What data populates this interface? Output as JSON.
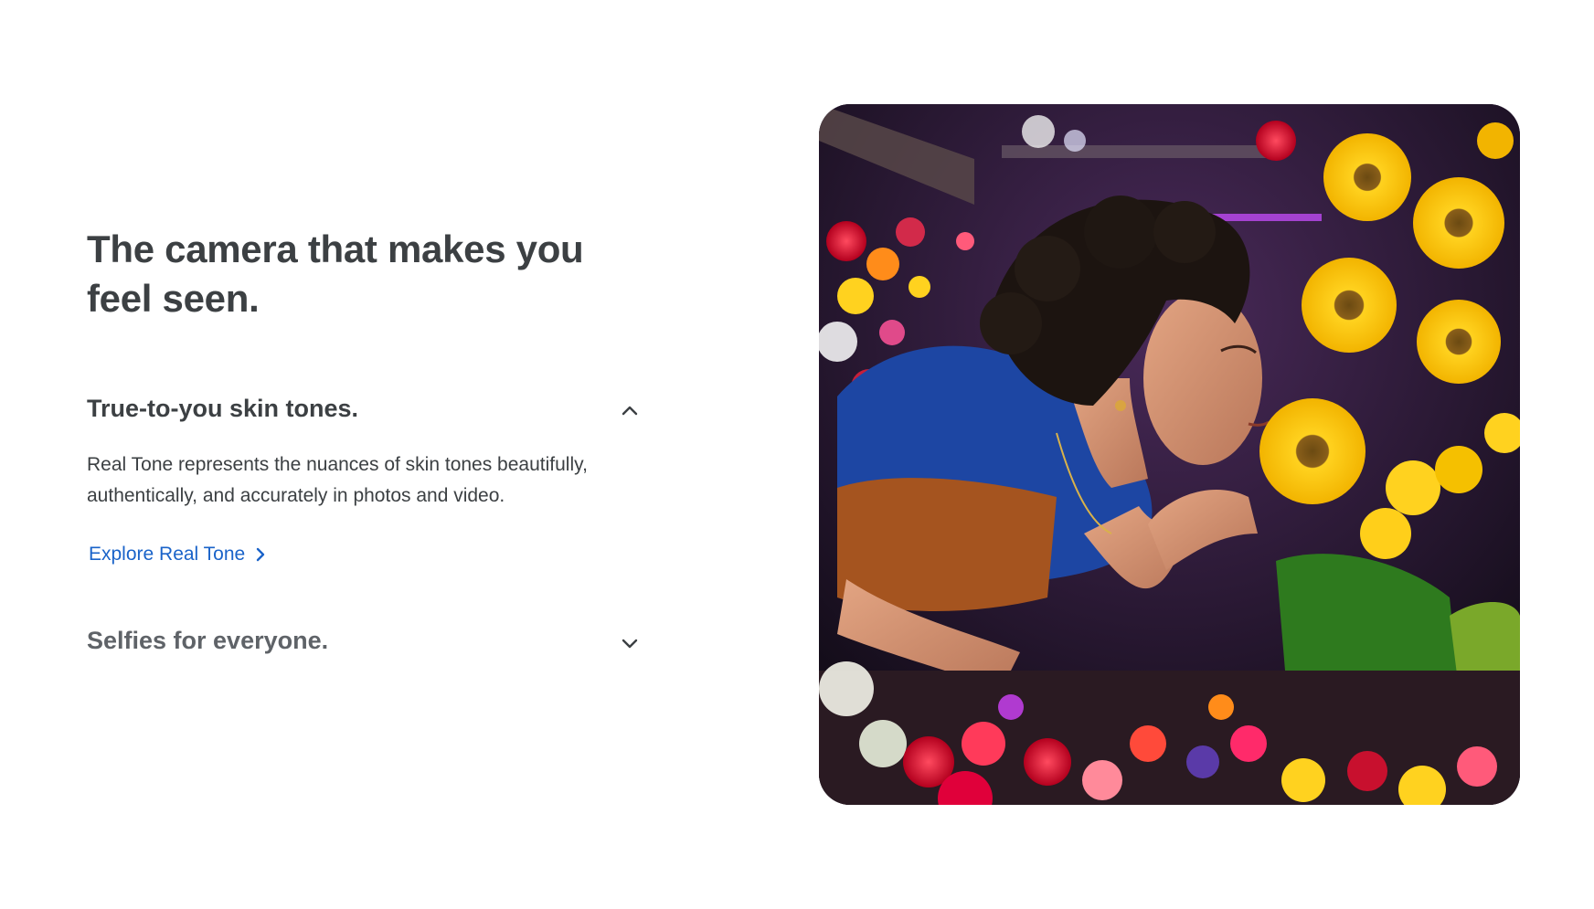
{
  "section": {
    "headline": "The camera that makes you feel seen."
  },
  "accordion": {
    "items": [
      {
        "title": "True-to-you skin tones.",
        "expanded": true,
        "icon": "chevron-up-icon",
        "body": "Real Tone represents the nuances of skin tones beautifully, authentically, and accurately in photos and video.",
        "link_label": "Explore Real Tone",
        "link_icon": "chevron-right-icon"
      },
      {
        "title": "Selfies for everyone.",
        "expanded": false,
        "icon": "chevron-down-icon"
      }
    ]
  },
  "hero_image": {
    "subject": "woman smelling sunflowers among a wall of colorful flowers"
  },
  "colors": {
    "heading": "#3c4043",
    "text": "#3c4043",
    "muted": "#5f6368",
    "link": "#1a63c9",
    "background": "#ffffff"
  }
}
